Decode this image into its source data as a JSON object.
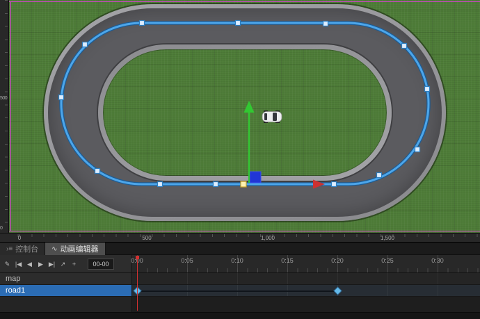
{
  "scene": {
    "ruler_x": {
      "labels": [
        "0",
        "500",
        "1,000",
        "1,500"
      ]
    },
    "ruler_y": {
      "labels": [
        "500",
        "0"
      ]
    },
    "colors": {
      "grass": "#4e7c38",
      "asphalt": "#5b5b5f",
      "track_edge": "#96969a",
      "spline": "#4da6ea",
      "scene_bounds": "#d843d0",
      "gizmo_y_axis": "#32c832",
      "gizmo_x_axis": "#cc3232",
      "gizmo_plane": "#2136d6",
      "selected_point": "#fdf2b3",
      "keyframe": "#64b9ea",
      "selection_row": "#2b6cb4"
    }
  },
  "panel": {
    "tabs": [
      {
        "icon": "console-icon",
        "icon_glyph": "›≡",
        "label": "控制台"
      },
      {
        "icon": "waveform-icon",
        "icon_glyph": "∿",
        "label": "动画编辑器"
      }
    ],
    "toolbar": [
      {
        "name": "edit",
        "glyph": "✎"
      },
      {
        "name": "go-start",
        "glyph": "|◀"
      },
      {
        "name": "prev-frame",
        "glyph": "◀"
      },
      {
        "name": "play",
        "glyph": "▶"
      },
      {
        "name": "next-frame",
        "glyph": "▶|"
      },
      {
        "name": "export",
        "glyph": "↗"
      },
      {
        "name": "add-key",
        "glyph": "+"
      }
    ],
    "time_field": {
      "value": "00-00"
    },
    "time_ruler": [
      "0:00",
      "0:05",
      "0:10",
      "0:15",
      "0:20",
      "0:25",
      "0:30"
    ],
    "tracks": [
      {
        "name": "map",
        "selected": false,
        "keyframes": []
      },
      {
        "name": "road1",
        "selected": true,
        "keyframes": [
          {
            "time": "0:00"
          },
          {
            "time": "0:20"
          }
        ]
      }
    ]
  }
}
